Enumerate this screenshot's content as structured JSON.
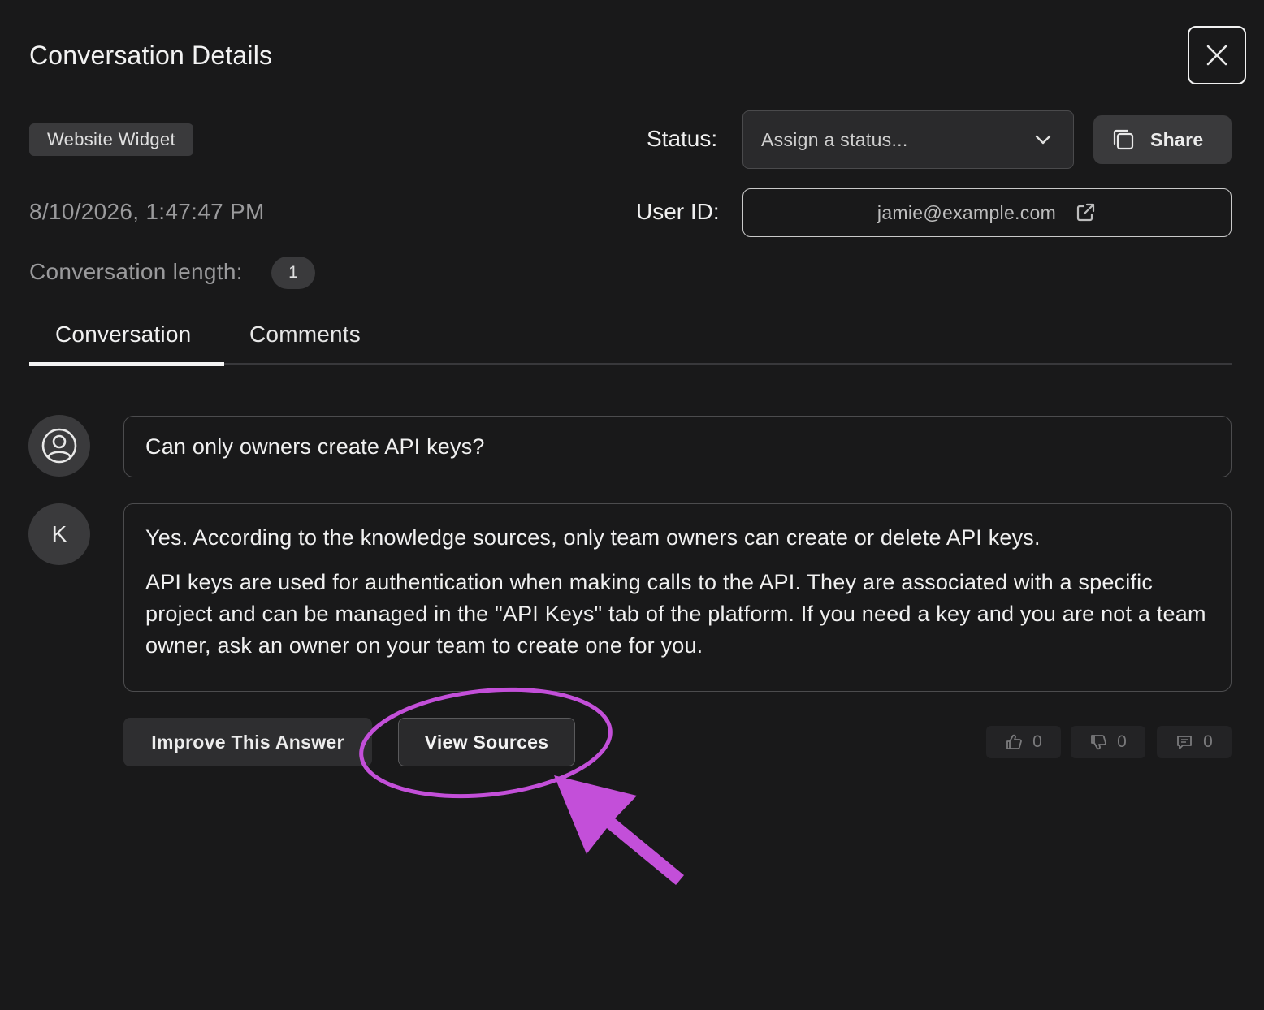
{
  "header": {
    "title": "Conversation Details"
  },
  "source_badge": "Website Widget",
  "status": {
    "label": "Status:",
    "placeholder": "Assign a status..."
  },
  "share": {
    "label": "Share"
  },
  "timestamp": "8/10/2026, 1:47:47 PM",
  "user_id": {
    "label": "User ID:",
    "value": "jamie@example.com"
  },
  "conversation_length": {
    "label": "Conversation length:",
    "value": "1"
  },
  "tabs": [
    {
      "label": "Conversation",
      "active": true
    },
    {
      "label": "Comments",
      "active": false
    }
  ],
  "messages": {
    "question": "Can only owners create API keys?",
    "bot_initial": "K",
    "answer_paragraphs": [
      "Yes. According to the knowledge sources, only team owners can create or delete API keys.",
      "API keys are used for authentication when making calls to the API. They are associated with a specific project and can be managed in the \"API Keys\" tab of the platform. If you need a key and you are not a team owner, ask an owner on your team to create one for you."
    ]
  },
  "actions": {
    "improve_label": "Improve This Answer",
    "sources_label": "View Sources"
  },
  "feedback": {
    "thumbs_up": "0",
    "thumbs_down": "0",
    "comments": "0"
  },
  "colors": {
    "background": "#19191a",
    "annotation": "#c34fd9"
  }
}
